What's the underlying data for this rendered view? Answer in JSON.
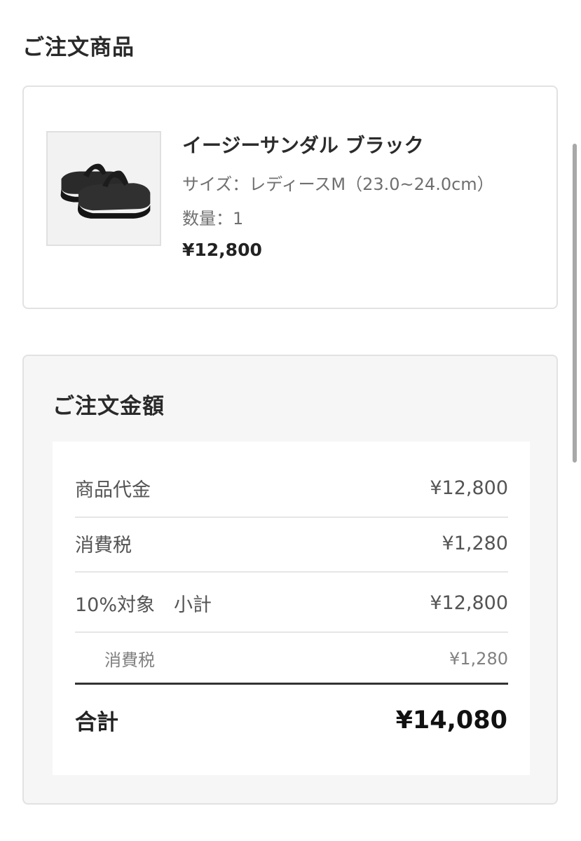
{
  "order_items": {
    "title": "ご注文商品",
    "product": {
      "image_alt": "sandal-image",
      "name": "イージーサンダル ブラック",
      "size": "サイズ：レディースM（23.0~24.0cm）",
      "quantity": "数量：1",
      "price": "¥12,800"
    }
  },
  "order_amount": {
    "title": "ご注文金額",
    "rows": [
      {
        "label": "商品代金",
        "value": "¥12,800"
      },
      {
        "label": "消費税",
        "value": "¥1,280"
      },
      {
        "label": "10%対象　小計",
        "value": "¥12,800"
      },
      {
        "label": "消費税",
        "value": "¥1,280"
      }
    ],
    "total_label": "合計",
    "total_value": "¥14,080"
  },
  "colors": {
    "card_border": "#e2e2e2",
    "summary_background": "#f6f6f6",
    "text_primary": "#222222",
    "text_secondary": "#6f6f6f"
  }
}
